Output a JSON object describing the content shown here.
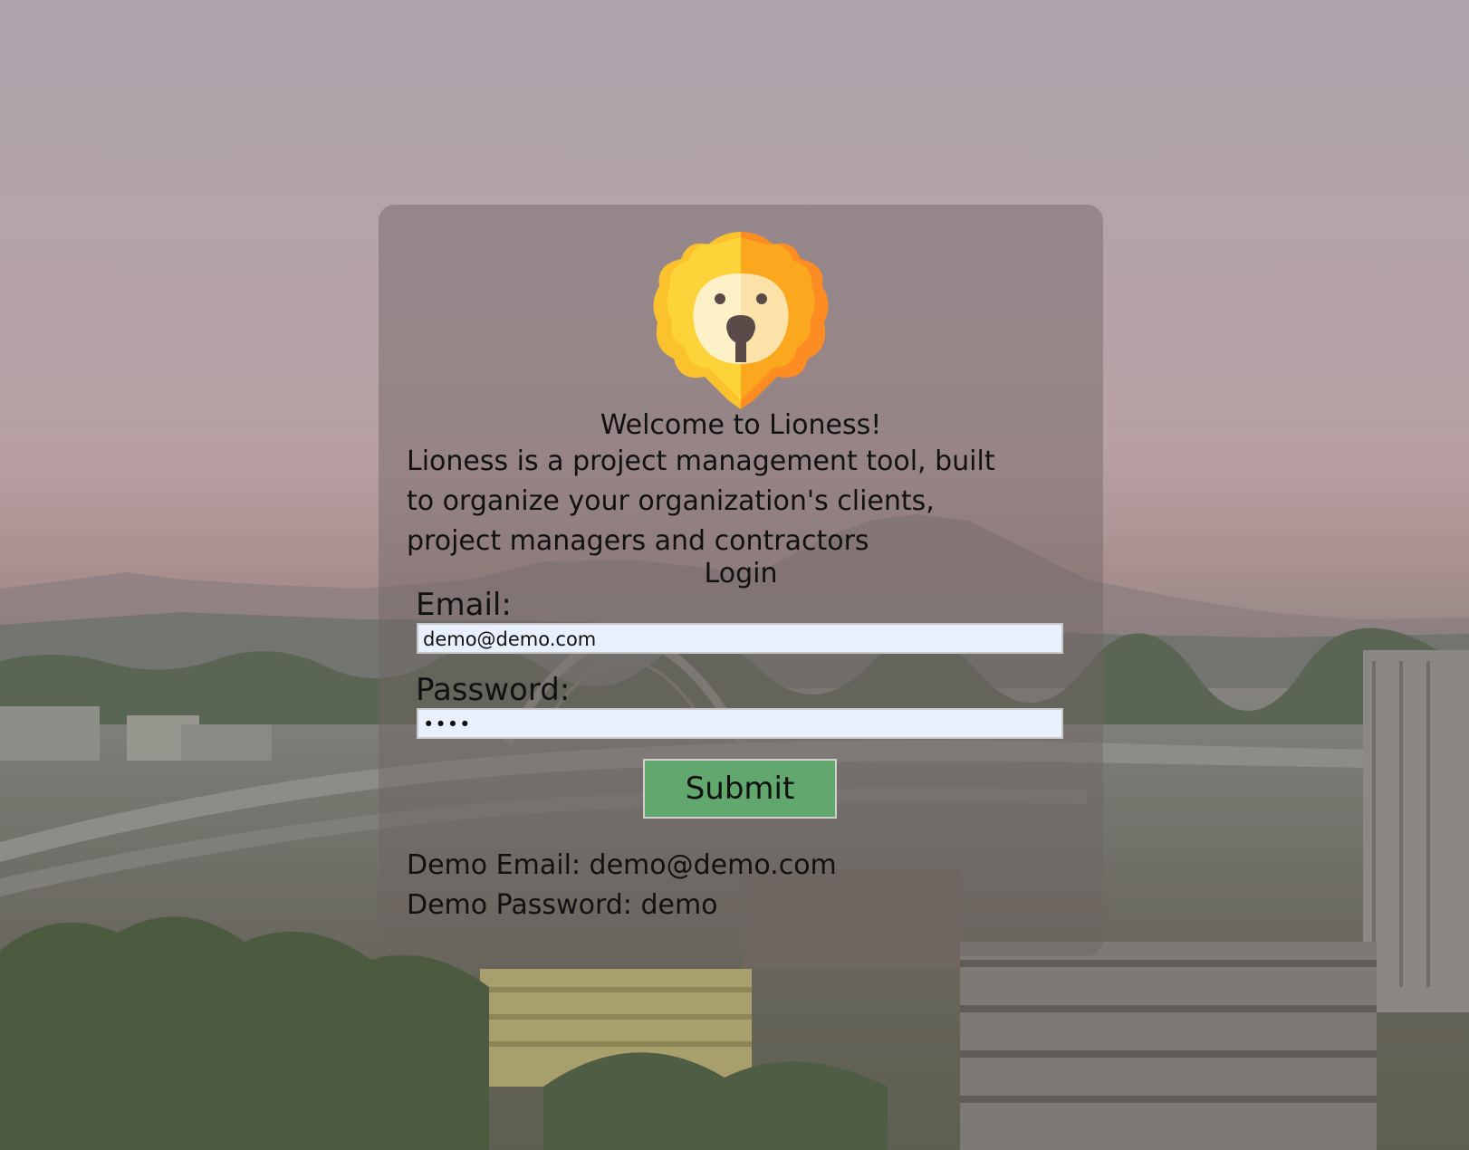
{
  "welcome": "Welcome to Lioness!",
  "description": "Lioness is a project management tool, built to organize your organization's clients, project managers and contractors",
  "login": {
    "title": "Login",
    "email_label": "Email:",
    "email_value": "demo@demo.com",
    "password_label": "Password:",
    "password_value": "••••",
    "submit_label": "Submit"
  },
  "demo": {
    "email": "Demo Email: demo@demo.com",
    "password": "Demo Password: demo"
  },
  "icons": {
    "logo": "lion-icon"
  },
  "colors": {
    "submit": "#62a86e",
    "input_bg": "#e8f0fe",
    "lion_left": "#fcc22d",
    "lion_right": "#fd8d22"
  }
}
